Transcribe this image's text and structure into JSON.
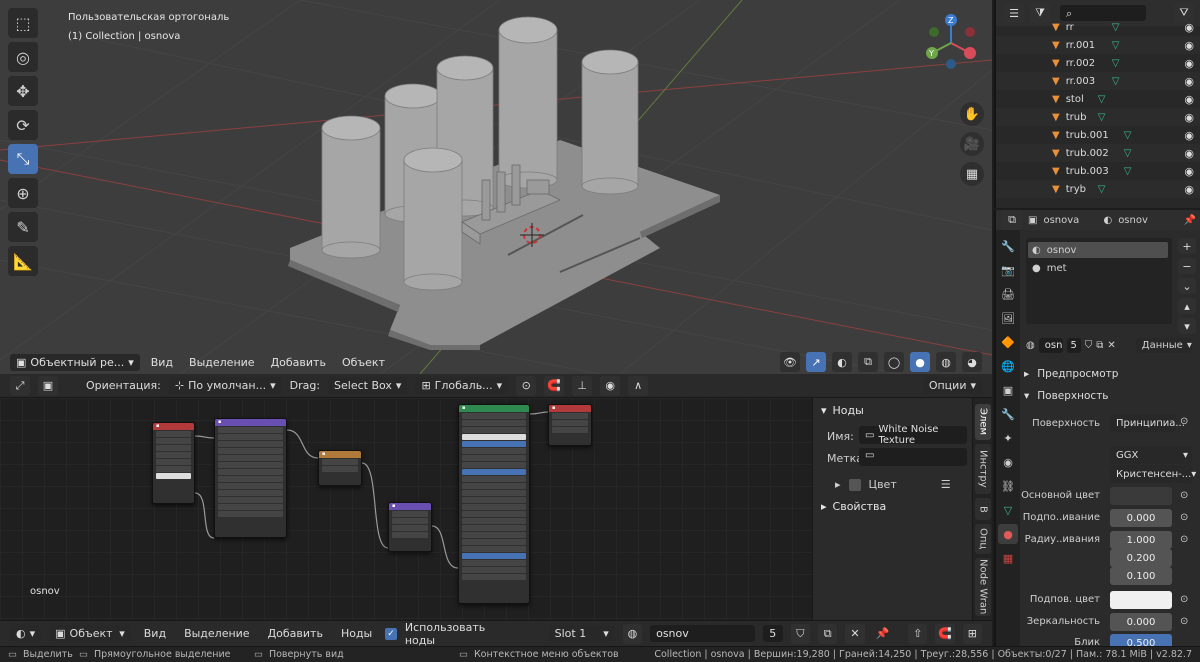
{
  "viewport": {
    "view_name": "Пользовательская ортогональ",
    "collection_info": "(1) Collection | osnova",
    "mode_label": "Объектный ре...",
    "menu": [
      "Вид",
      "Выделение",
      "Добавить",
      "Объект"
    ]
  },
  "tool_settings": {
    "orientation_label": "Ориентация:",
    "orientation_value": "По умолчан...",
    "drag_label": "Drag:",
    "drag_value": "Select Box",
    "transform_value": "Глобаль...",
    "options_label": "Опции"
  },
  "node_editor": {
    "object_label": "osnov",
    "npanel": {
      "section_nodes": "Ноды",
      "name_label": "Имя:",
      "name_value": "White Noise Texture",
      "label_label": "Метка:",
      "color_label": "Цвет",
      "props_label": "Свойства"
    },
    "tabs": [
      "Элем",
      "Инстру",
      "В",
      "Опц",
      "Node Wran"
    ],
    "header": {
      "mode_value": "Объект",
      "menu": [
        "Вид",
        "Выделение",
        "Добавить",
        "Ноды"
      ],
      "use_nodes_label": "Использовать ноды",
      "slot_value": "Slot 1",
      "material_name": "osnov",
      "user_count": "5"
    }
  },
  "statusbar": {
    "select": "Выделить",
    "box_select": "Прямоугольное выделение",
    "rotate_view": "Повернуть вид",
    "context_menu": "Контекстное меню объектов",
    "stats": "Collection | osnova | Вершин:19,280 | Граней:14,250 | Треуг.:28,556 | Объекты:0/27 | Пам.: 78.1 MiB | v2.82.7"
  },
  "outliner": {
    "items": [
      {
        "name": "rr"
      },
      {
        "name": "rr.001"
      },
      {
        "name": "rr.002"
      },
      {
        "name": "rr.003"
      },
      {
        "name": "stol"
      },
      {
        "name": "trub"
      },
      {
        "name": "trub.001"
      },
      {
        "name": "trub.002"
      },
      {
        "name": "trub.003"
      },
      {
        "name": "tryb"
      }
    ]
  },
  "properties": {
    "object_name": "osnova",
    "material_header": "osnov",
    "slots": [
      "osnov",
      "met"
    ],
    "material_field": "osn",
    "material_users": "5",
    "data_label": "Данные",
    "preview_label": "Предпросмотр",
    "surface_label": "Поверхность",
    "surface_field_label": "Поверхность",
    "surface_value": "Принципиа...",
    "distribution": "GGX",
    "subsurface_method": "Кристенсен-...",
    "base_color_label": "Основной цвет",
    "subsurface_label": "Подпо..ивание",
    "subsurface_value": "0.000",
    "radius_label": "Радиу..ивания",
    "radius_values": [
      "1.000",
      "0.200",
      "0.100"
    ],
    "subsurface_color_label": "Подпов. цвет",
    "specular_label": "Зеркальность",
    "specular_value": "0.000",
    "sheen_label": "Блик",
    "sheen_value": "0.500"
  }
}
